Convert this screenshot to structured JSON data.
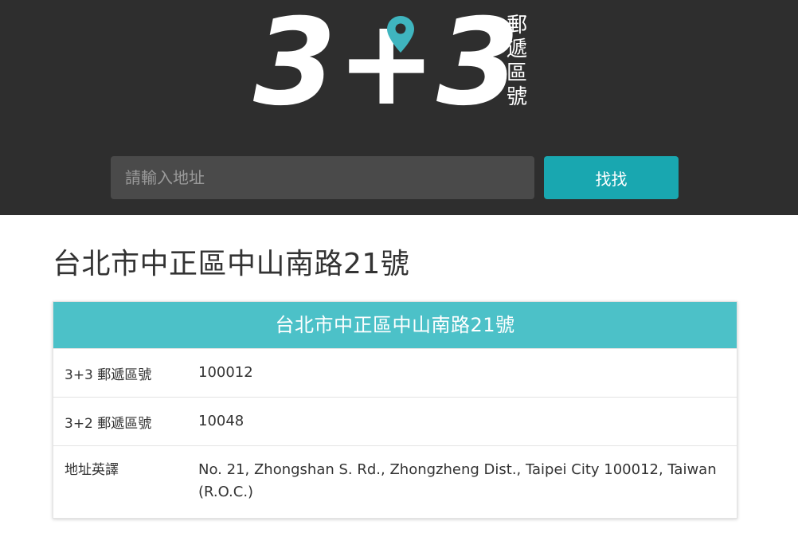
{
  "header": {
    "logo": {
      "numerals": "3+3",
      "tagline_chars": [
        "郵",
        "遞",
        "區",
        "號"
      ],
      "pin_color": "#3fb5bf"
    },
    "search": {
      "placeholder": "請輸入地址",
      "value": "",
      "button_label": "找找"
    }
  },
  "main": {
    "page_title": "台北市中正區中山南路21號",
    "card": {
      "header_title": "台北市中正區中山南路21號",
      "rows": [
        {
          "label": "3+3 郵遞區號",
          "value": "100012"
        },
        {
          "label": "3+2 郵遞區號",
          "value": "10048"
        },
        {
          "label": "地址英譯",
          "value": "No. 21, Zhongshan S. Rd., Zhongzheng Dist., Taipei City 100012, Taiwan (R.O.C.)"
        }
      ]
    }
  },
  "colors": {
    "header_bg": "#2e2e2e",
    "accent": "#19a7b0",
    "card_header": "#4cc1c8"
  }
}
